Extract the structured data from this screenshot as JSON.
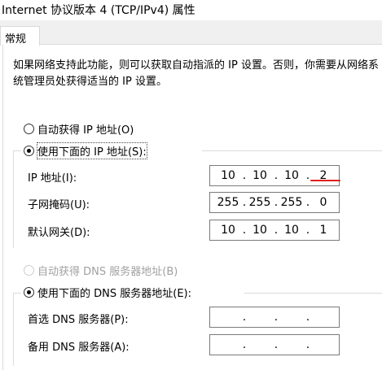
{
  "window": {
    "title": "Internet 协议版本 4 (TCP/IPv4) 属性"
  },
  "tabs": [
    {
      "label": "常规",
      "active": true
    }
  ],
  "description": {
    "line1": "如果网络支持此功能，则可以获取自动指派的 IP 设置。否则，你需要从网络系",
    "line2": "统管理员处获得适当的 IP 设置。"
  },
  "ip_mode": {
    "auto": {
      "label": "自动获得 IP 地址(O)",
      "selected": false
    },
    "manual": {
      "label": "使用下面的 IP 地址(S):",
      "selected": true
    }
  },
  "ip_fields": [
    {
      "label": "IP 地址(I):",
      "octets": [
        "10",
        "10",
        "10",
        "2"
      ]
    },
    {
      "label": "子网掩码(U):",
      "octets": [
        "255",
        "255",
        "255",
        "0"
      ]
    },
    {
      "label": "默认网关(D):",
      "octets": [
        "10",
        "10",
        "10",
        "1"
      ]
    }
  ],
  "dns_mode": {
    "auto": {
      "label": "自动获得 DNS 服务器地址(B)",
      "selected": false,
      "disabled": true
    },
    "manual": {
      "label": "使用下面的 DNS 服务器地址(E):",
      "selected": true
    }
  },
  "dns_fields": [
    {
      "label": "首选 DNS 服务器(P):",
      "octets": [
        "",
        "",
        "",
        ""
      ]
    },
    {
      "label": "备用 DNS 服务器(A):",
      "octets": [
        "",
        "",
        "",
        ""
      ]
    }
  ],
  "annotation_color": "#e0201c"
}
